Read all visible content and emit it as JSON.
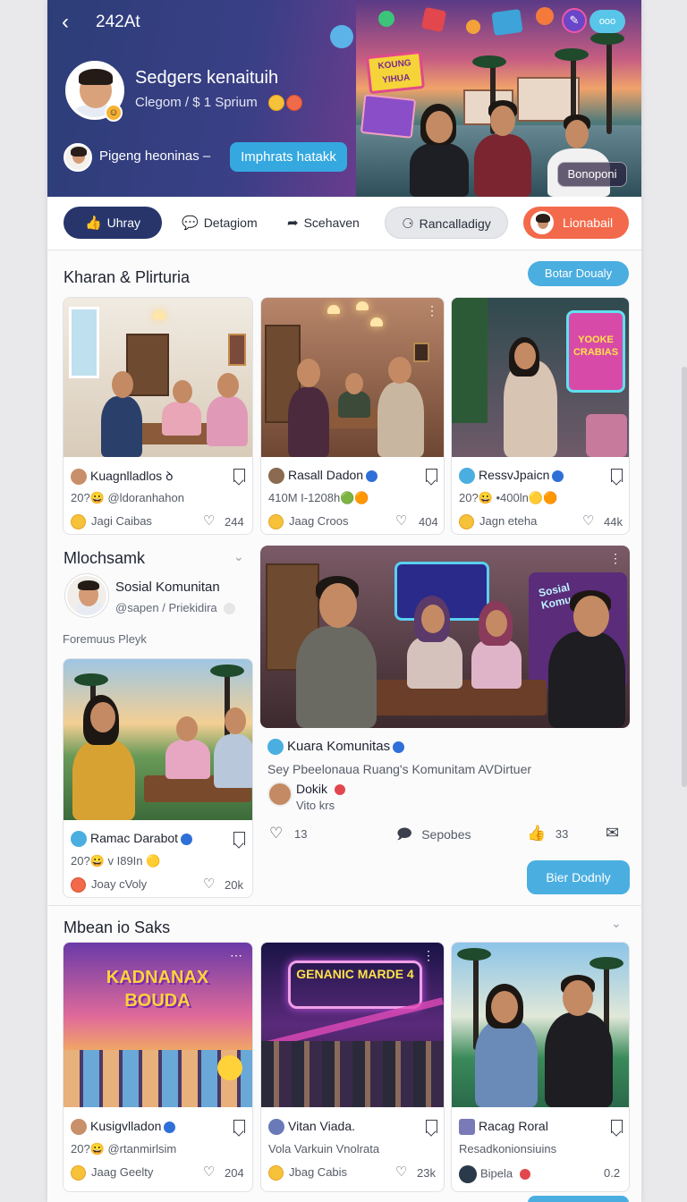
{
  "header": {
    "back_icon": "chevron-left-icon",
    "title": "242At",
    "profile_name": "Sedgers kenaituih",
    "profile_sub": "Clegom / $ 1 Sprium",
    "link_text": "Pigeng heoninas –",
    "cta_label": "Imphrats hatakk",
    "scene_tag": "Bonoponi",
    "top_pill": "ooo",
    "sign_text": "KOUNG YIHUA"
  },
  "actions": {
    "like": "Uhray",
    "discuss": "Detagiom",
    "share": "Scehaven",
    "recommend": "Rancalladigy",
    "join": "Lionabail"
  },
  "section1": {
    "title": "Kharan & Plirturia",
    "button": "Botar Doualy",
    "cards": [
      {
        "name": "Kuagnlladlos",
        "suffix": "ꝺ",
        "meta": "20?😀 @ldoranhahon",
        "footer": "Jagi Caibas",
        "likes": "244"
      },
      {
        "name": "Rasall Dadon",
        "meta": "410M I-1208h🟢🟠",
        "footer": "Jaag Croos",
        "likes": "404"
      },
      {
        "name": "RessvJpaicn",
        "meta": "20?😀 •400ln🟡🟠",
        "footer": "Jagn eteha",
        "likes": "44k",
        "neon_sign": "YOOKE CRABIAS"
      }
    ]
  },
  "section2": {
    "title": "Mlochsamk",
    "profile_name": "Sosial Komunitan",
    "profile_sub": "@sapen / Priekidira",
    "label": "Foremuus Pleyk",
    "small_card": {
      "name": "Ramac Darabot",
      "meta": "20?😀 v I89In 🟡",
      "footer": "Joay cVoly",
      "likes": "20k"
    },
    "feature": {
      "title": "Kuara Komunitas",
      "desc": "Sey Pbeelonaua Ruang's Komunitam AVDirtuer",
      "author": "Dokik",
      "author_sub": "Vito krs",
      "likes": "13",
      "comments": "Sepobes",
      "shares": "33",
      "button": "Bier Dodnly",
      "neon_sign": "Sosial Komun"
    }
  },
  "section3": {
    "title": "Mbean io Saks",
    "cards": [
      {
        "name": "Kusigvlladon",
        "meta": "20?😀 @rtanmirlsim",
        "footer": "Jaag Geelty",
        "likes": "204",
        "banner": "KADNANAX BOUDA"
      },
      {
        "name": "Vitan Viada.",
        "meta": "Vola Varkuin Vnolrata",
        "footer": "Jbag Cabis",
        "likes": "23k",
        "banner": "GENANIC MARDE 4"
      },
      {
        "name": "Racag Roral",
        "meta": "Resadkonionsiuins",
        "footer": "Bipela",
        "likes": "0.2"
      }
    ]
  },
  "colors": {
    "accent_blue": "#4aaee0",
    "navy": "#27356b",
    "orange": "#f26a4b",
    "verified": "#2f6fd8"
  }
}
